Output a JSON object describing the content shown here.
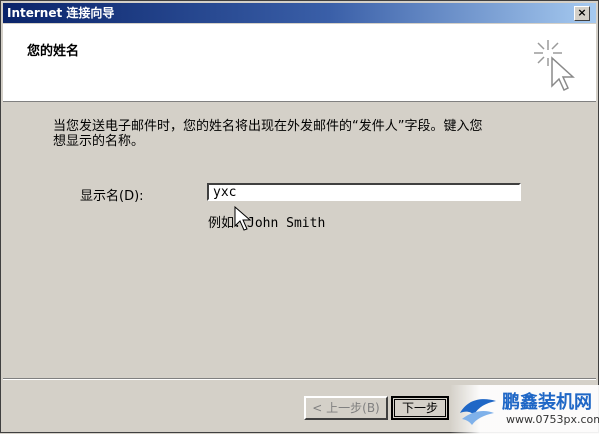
{
  "window": {
    "title": "Internet 连接向导",
    "close_label": "×"
  },
  "header": {
    "title": "您的姓名"
  },
  "body": {
    "description_line1": "当您发送电子邮件时，您的姓名将出现在外发邮件的“发件人”字段。键入您",
    "description_line2": "想显示的名称。",
    "display_name_label": "显示名(D):",
    "display_name_value": "yxc",
    "example_prefix": "例如：",
    "example_name": "John Smith"
  },
  "buttons": {
    "back_label": "< 上一步(B)",
    "next_label": "下一步"
  },
  "watermark": {
    "name": "鹏鑫装机网",
    "url": "www.0753px.com"
  },
  "colors": {
    "titlebar_start": "#0a246a",
    "titlebar_end": "#a6caf0",
    "dialog_face": "#d4d0c8",
    "watermark_blue": "#1f67c6"
  }
}
